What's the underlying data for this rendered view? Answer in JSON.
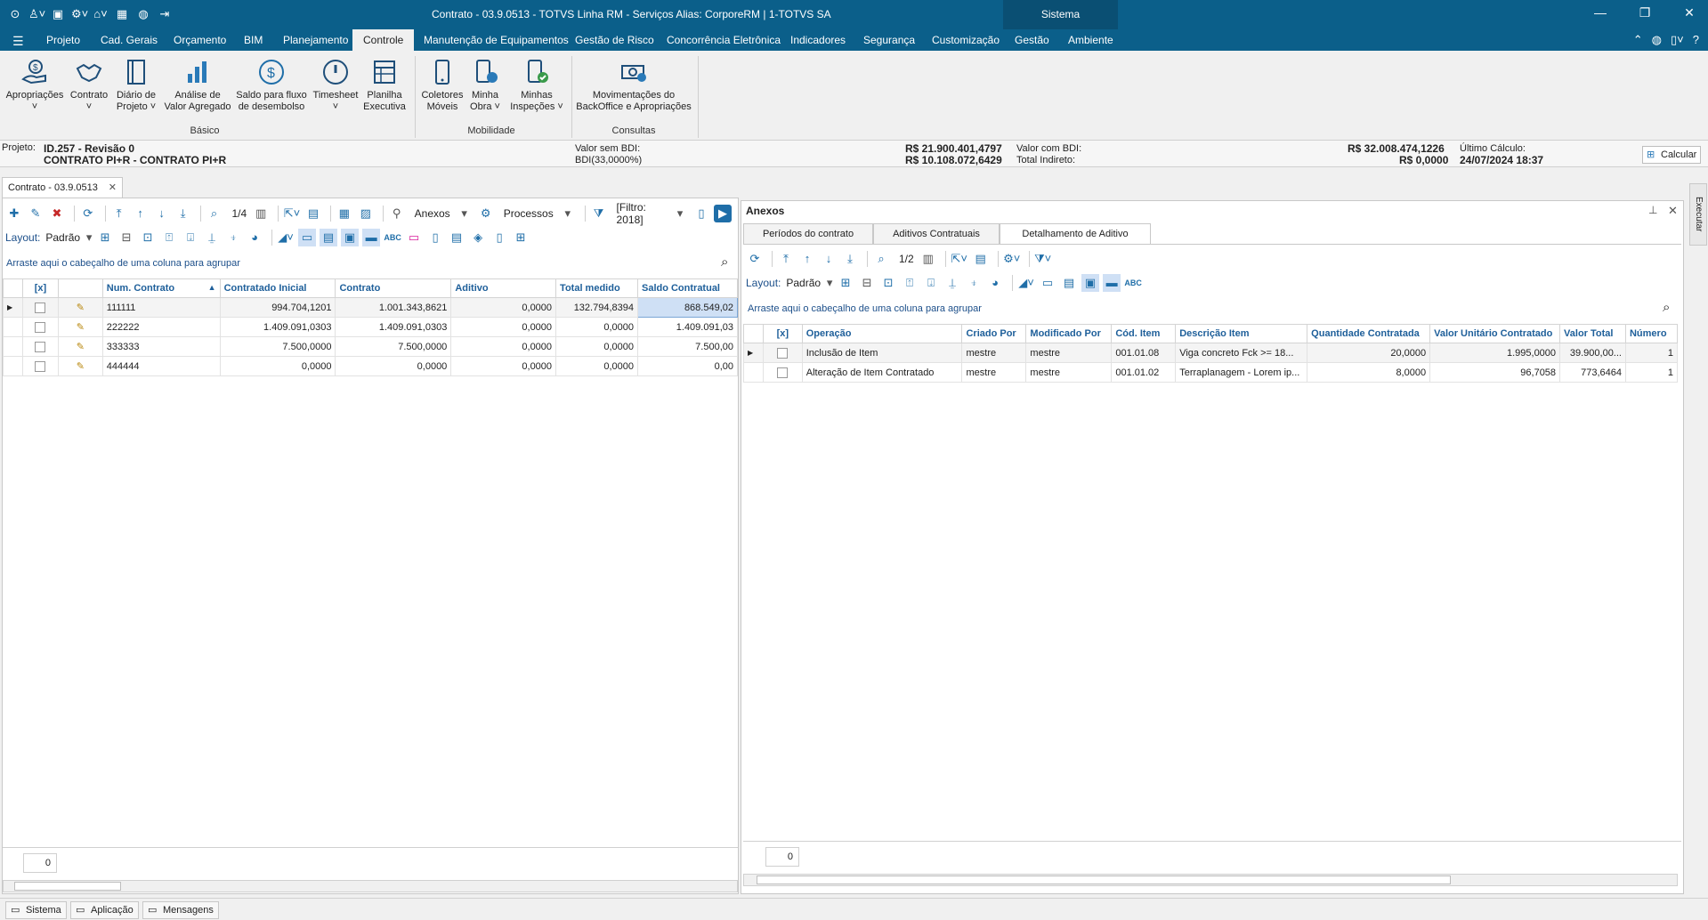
{
  "window": {
    "title": "Contrato - 03.9.0513 - TOTVS Linha RM - Serviços  Alias: CorporeRM | 1-TOTVS SA",
    "sistema": "Sistema"
  },
  "menu": {
    "tabs": [
      "Projeto",
      "Cad. Gerais",
      "Orçamento",
      "BIM",
      "Planejamento",
      "Controle",
      "Manutenção de Equipamentos",
      "Gestão de Risco",
      "Concorrência Eletrônica",
      "Indicadores",
      "Segurança",
      "Customização",
      "Gestão",
      "Ambiente"
    ],
    "active": "Controle"
  },
  "ribbon": {
    "buttons": [
      {
        "label1": "Apropriações",
        "label2": "˅"
      },
      {
        "label1": "Contrato",
        "label2": "˅"
      },
      {
        "label1": "Diário de",
        "label2": "Projeto ˅"
      },
      {
        "label1": "Análise de",
        "label2": "Valor Agregado"
      },
      {
        "label1": "Saldo para fluxo",
        "label2": "de desembolso"
      },
      {
        "label1": "Timesheet",
        "label2": "˅"
      },
      {
        "label1": "Planilha",
        "label2": "Executiva"
      },
      {
        "label1": "Coletores",
        "label2": "Móveis"
      },
      {
        "label1": "Minha",
        "label2": "Obra ˅"
      },
      {
        "label1": "Minhas",
        "label2": "Inspeções ˅"
      },
      {
        "label1": "Movimentações do",
        "label2": "BackOffice e Apropriações"
      }
    ],
    "groups": [
      "Básico",
      "Mobilidade",
      "Consultas"
    ]
  },
  "info": {
    "projeto_label": "Projeto:",
    "projeto_id": "ID.257 - Revisão 0",
    "projeto_nome": "CONTRATO PI+R - CONTRATO PI+R",
    "vsb_label": "Valor sem BDI:",
    "bdi_label": "BDI(33,0000%)",
    "vsb_value": "R$ 21.900.401,4797",
    "bdi_value": "R$ 10.108.072,6429",
    "vcb_label": "Valor com BDI:",
    "ti_label": "Total Indireto:",
    "vcb_value": "R$ 32.008.474,1226",
    "ti_value": "R$ 0,0000",
    "uc_label": "Último Cálculo:",
    "uc_value": "24/07/2024 18:37",
    "calc": "Calcular"
  },
  "doc_tab": "Contrato - 03.9.0513",
  "left": {
    "toolbar": {
      "page": "1/4",
      "anexos": "Anexos",
      "processos": "Processos",
      "filtro": "[Filtro: 2018]"
    },
    "layout_label": "Layout:",
    "layout_value": "Padrão",
    "group_hint": "Arraste aqui o cabeçalho de uma coluna para agrupar",
    "columns": [
      "[x]",
      "",
      "Num. Contrato",
      "Contratado Inicial",
      "Contrato",
      "Aditivo",
      "Total medido",
      "Saldo Contratual"
    ],
    "rows": [
      {
        "num": "111111",
        "ci": "994.704,1201",
        "c": "1.001.343,8621",
        "a": "0,0000",
        "tm": "132.794,8394",
        "sc": "868.549,02"
      },
      {
        "num": "222222",
        "ci": "1.409.091,0303",
        "c": "1.409.091,0303",
        "a": "0,0000",
        "tm": "0,0000",
        "sc": "1.409.091,03"
      },
      {
        "num": "333333",
        "ci": "7.500,0000",
        "c": "7.500,0000",
        "a": "0,0000",
        "tm": "0,0000",
        "sc": "7.500,00"
      },
      {
        "num": "444444",
        "ci": "0,0000",
        "c": "0,0000",
        "a": "0,0000",
        "tm": "0,0000",
        "sc": "0,00"
      }
    ],
    "counter": "0"
  },
  "right": {
    "title": "Anexos",
    "tabs": [
      "Períodos do contrato",
      "Aditivos Contratuais",
      "Detalhamento de Aditivo"
    ],
    "page": "1/2",
    "layout_label": "Layout:",
    "layout_value": "Padrão",
    "group_hint": "Arraste aqui o cabeçalho de uma coluna para agrupar",
    "columns": [
      "[x]",
      "Operação",
      "Criado Por",
      "Modificado Por",
      "Cód. Item",
      "Descrição Item",
      "Quantidade Contratada",
      "Valor Unitário Contratado",
      "Valor Total",
      "Número"
    ],
    "rows": [
      {
        "op": "Inclusão de Item",
        "cp": "mestre",
        "mp": "mestre",
        "cod": "001.01.08",
        "desc": "Viga concreto Fck >= 18...",
        "qtd": "20,0000",
        "vu": "1.995,0000",
        "vt": "39.900,00...",
        "n": "1"
      },
      {
        "op": "Alteração de Item Contratado",
        "cp": "mestre",
        "mp": "mestre",
        "cod": "001.01.02",
        "desc": "Terraplanagem - Lorem ip...",
        "qtd": "8,0000",
        "vu": "96,7058",
        "vt": "773,6464",
        "n": "1"
      }
    ],
    "counter": "0"
  },
  "sidebar": "Executar",
  "status": [
    "Sistema",
    "Aplicação",
    "Mensagens"
  ]
}
